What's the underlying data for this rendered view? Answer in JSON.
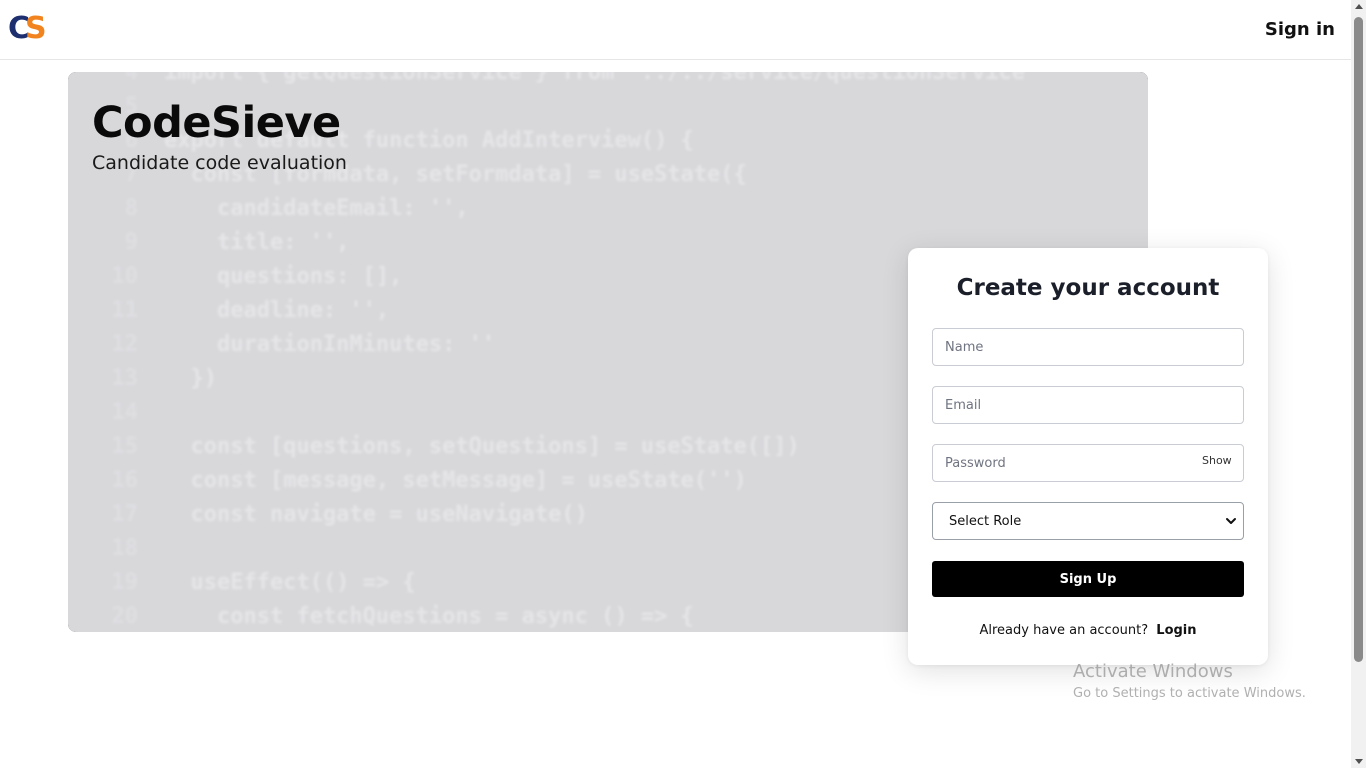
{
  "header": {
    "logo_letters": [
      "C",
      "S"
    ],
    "signin_label": "Sign in"
  },
  "hero": {
    "title": "CodeSieve",
    "subtitle": "Candidate code evaluation",
    "code_lines": [
      {
        "n": "4",
        "text": "import { getQuestionService } from '../../service/questionService'"
      },
      {
        "n": "5",
        "text": ""
      },
      {
        "n": "6",
        "text": "export default function AddInterview() {"
      },
      {
        "n": "7",
        "text": "  const [formdata, setFormdata] = useState({"
      },
      {
        "n": "8",
        "text": "    candidateEmail: '',"
      },
      {
        "n": "9",
        "text": "    title: '',"
      },
      {
        "n": "10",
        "text": "    questions: [],"
      },
      {
        "n": "11",
        "text": "    deadline: '',"
      },
      {
        "n": "12",
        "text": "    durationInMinutes: ''"
      },
      {
        "n": "13",
        "text": "  })"
      },
      {
        "n": "14",
        "text": ""
      },
      {
        "n": "15",
        "text": "  const [questions, setQuestions] = useState([])"
      },
      {
        "n": "16",
        "text": "  const [message, setMessage] = useState('')"
      },
      {
        "n": "17",
        "text": "  const navigate = useNavigate()"
      },
      {
        "n": "18",
        "text": ""
      },
      {
        "n": "19",
        "text": "  useEffect(() => {"
      },
      {
        "n": "20",
        "text": "    const fetchQuestions = async () => {"
      }
    ]
  },
  "signup": {
    "title": "Create your account",
    "name_placeholder": "Name",
    "email_placeholder": "Email",
    "password_placeholder": "Password",
    "show_label": "Show",
    "role_selected": "Select Role",
    "submit_label": "Sign Up",
    "login_prompt": "Already have an account?",
    "login_label": "Login"
  },
  "watermark": {
    "title": "Activate Windows",
    "subtitle": "Go to Settings to activate Windows."
  },
  "colors": {
    "logo_c": "#1d2f6e",
    "logo_s": "#f2841f",
    "button_bg": "#000000",
    "card_bg": "#ffffff"
  }
}
